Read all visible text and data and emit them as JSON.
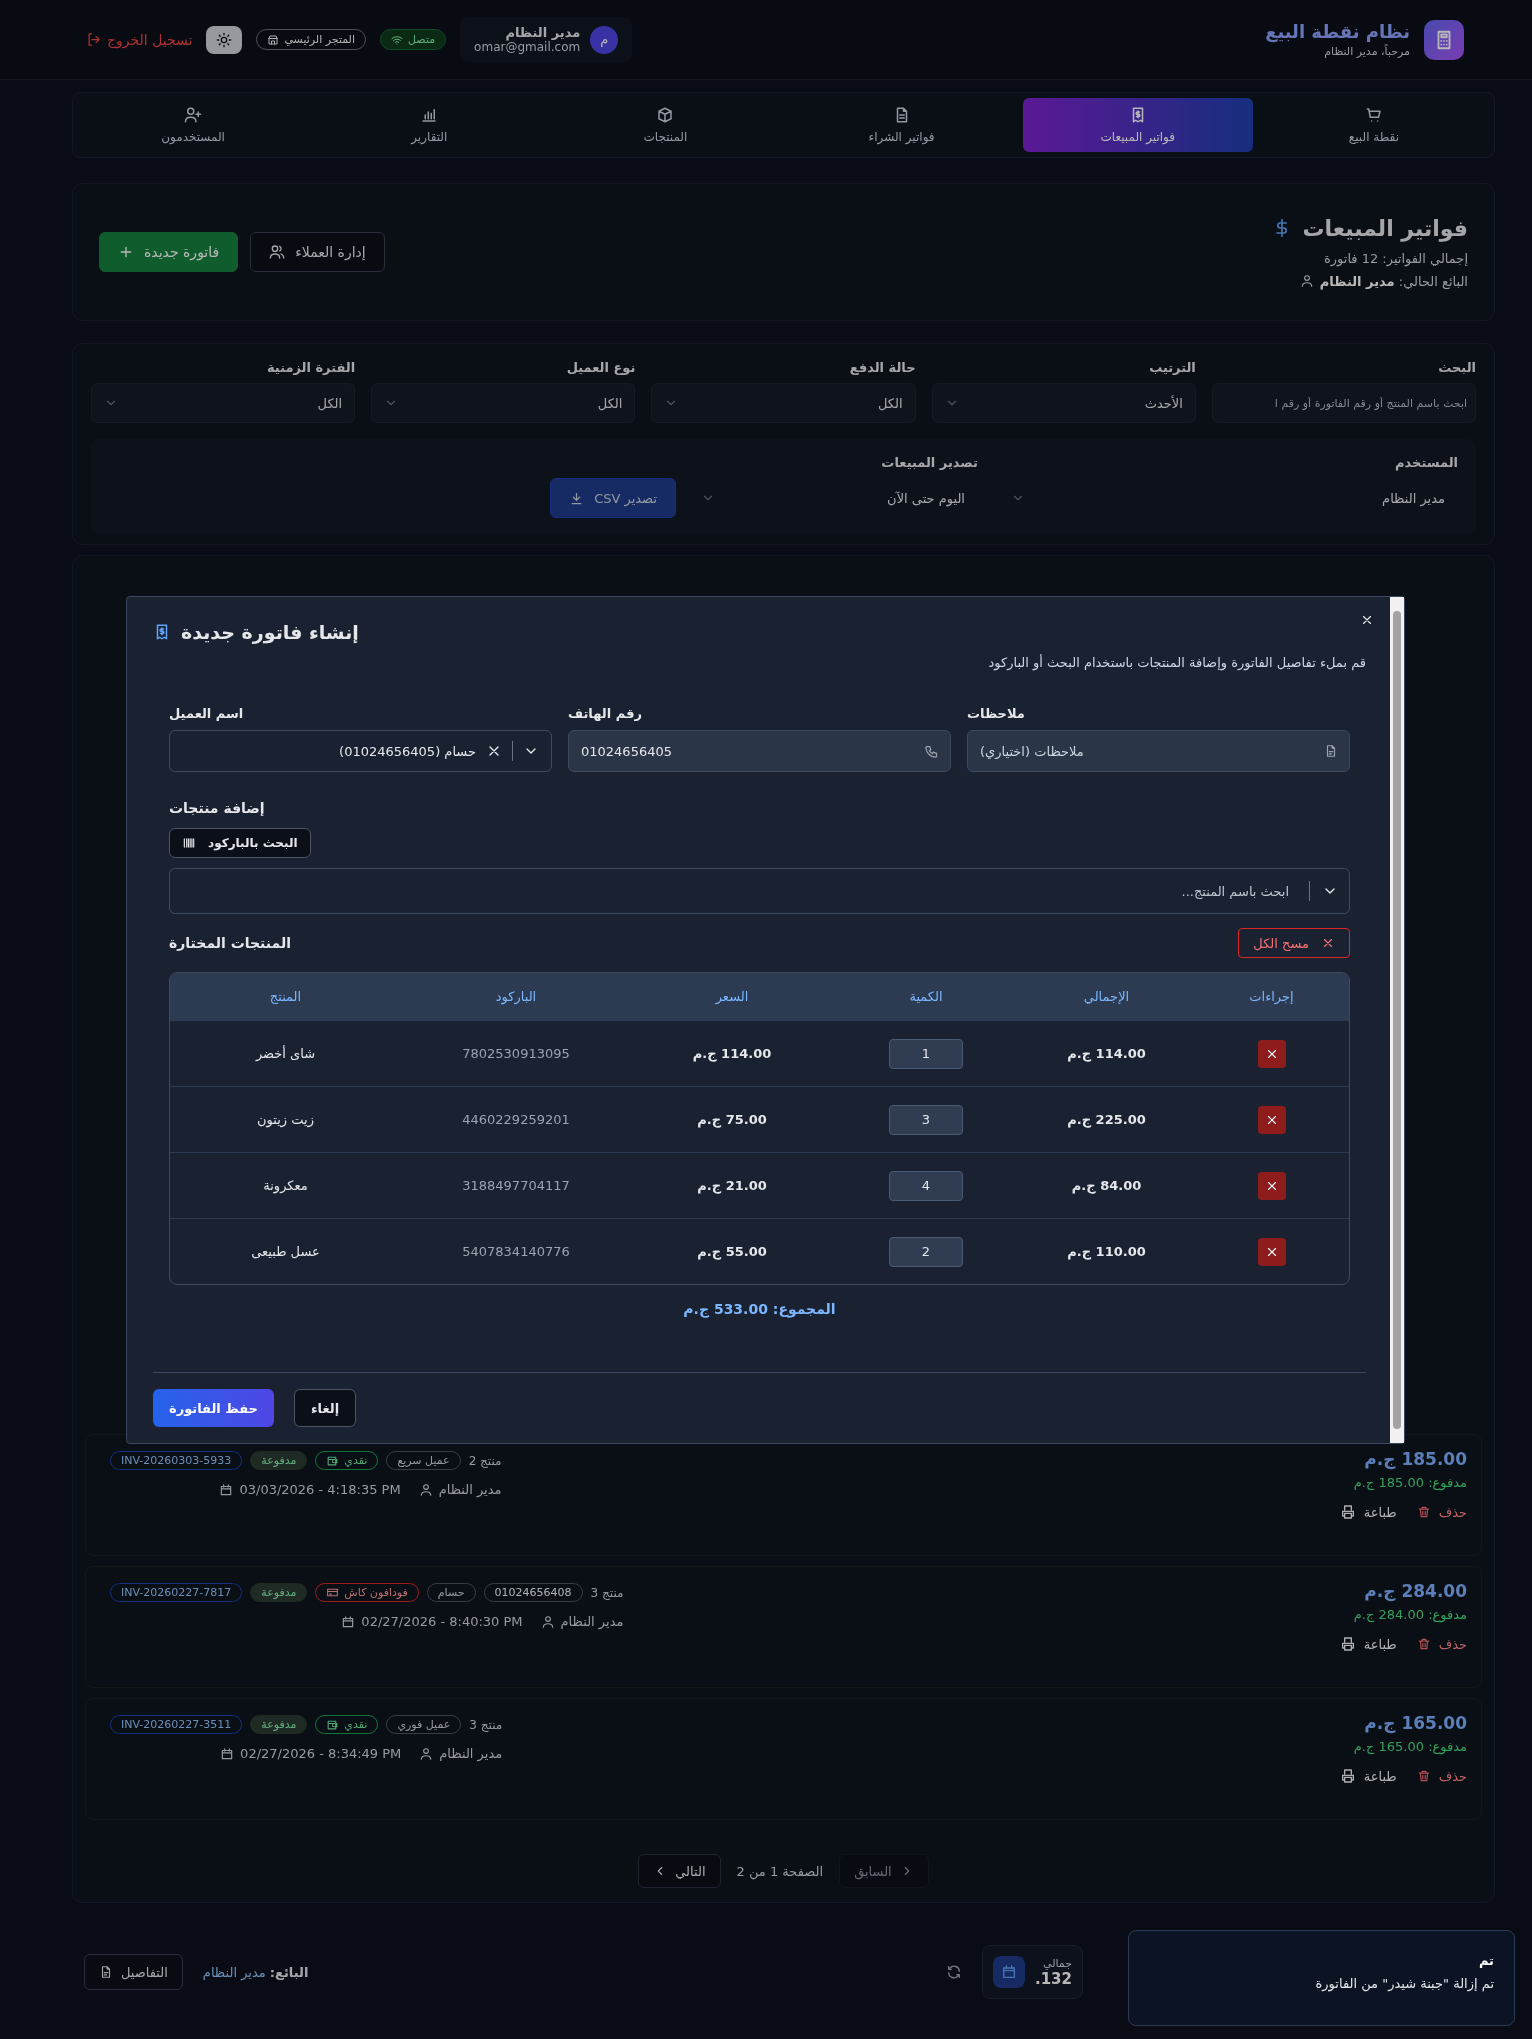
{
  "header": {
    "title": "نظام نقطة البيع",
    "subtitle": "مرحباً، مدير النظام",
    "user": {
      "avatar": "م",
      "name": "مدير النظام",
      "email": "omar@gmail.com"
    },
    "connection": {
      "label": "متصل",
      "online": true
    },
    "store": "المتجر الرئيسي",
    "logout": "تسجيل الخروج"
  },
  "nav": [
    {
      "label": "نقطة البيع",
      "kind": "cart",
      "selected": false
    },
    {
      "label": "فواتير المبيعات",
      "kind": "receipt",
      "selected": true
    },
    {
      "label": "فواتير الشراء",
      "kind": "file",
      "selected": false
    },
    {
      "label": "المنتجات",
      "kind": "box",
      "selected": false
    },
    {
      "label": "التقارير",
      "kind": "chart",
      "selected": false
    },
    {
      "label": "المستخدمون",
      "kind": "users",
      "selected": false
    }
  ],
  "page": {
    "title": "فواتير المبيعات",
    "total": "إجمالي الفواتير: 12 فاتورة",
    "seller": "البائع الحالي: **مدير النظام**",
    "buttons": [
      {
        "label": "إدارة العملاء",
        "kind": "outline"
      },
      {
        "label": "فاتورة جديدة",
        "kind": "primary"
      }
    ]
  },
  "filters": [
    {
      "label": "البحث",
      "kind": "input",
      "placeholder": "ابحث باسم المنتج أو رقم الفاتورة أو رقم ا"
    },
    {
      "label": "الترتيب",
      "kind": "select",
      "value": "الأحدث"
    },
    {
      "label": "حالة الدفع",
      "kind": "select",
      "value": "الكل"
    },
    {
      "label": "نوع العميل",
      "kind": "select",
      "value": "الكل"
    },
    {
      "label": "الفترة الزمنية",
      "kind": "select",
      "value": "الكل"
    }
  ],
  "export": {
    "user_label": "المستخدم",
    "user_value": "مدير النظام",
    "label": "تصدير المبيعات",
    "period": "اليوم حتى الآن",
    "button": "تصدير CSV"
  },
  "invoices": [
    {
      "items": "منتج 2",
      "tags": [
        {
          "text": "عميل سريع",
          "kind": "customer"
        },
        {
          "text": "نقدي",
          "kind": "cash"
        },
        {
          "text": "مدفوعة",
          "kind": "status"
        },
        {
          "text": "INV-20260303-5933",
          "kind": "id"
        }
      ],
      "user": "مدير النظام",
      "date": "03/03/2026 - 4:18:35 PM",
      "amount": "185.00 ج.م",
      "paid": "مدفوع: 185.00 ج.م",
      "actions": [
        {
          "label": "حذف",
          "kind": "delete"
        },
        {
          "label": "طباعة",
          "kind": "print"
        }
      ]
    },
    {
      "items": "منتج 3",
      "tags": [
        {
          "text": "01024656408",
          "kind": "phone"
        },
        {
          "text": "حسام",
          "kind": "customer"
        },
        {
          "text": "فودافون كاش",
          "kind": "mobile_wallet"
        },
        {
          "text": "مدفوعة",
          "kind": "status"
        },
        {
          "text": "INV-20260227-7817",
          "kind": "id"
        }
      ],
      "user": "مدير النظام",
      "date": "02/27/2026 - 8:40:30 PM",
      "amount": "284.00 ج.م",
      "paid": "مدفوع: 284.00 ج.م",
      "actions": [
        {
          "label": "حذف",
          "kind": "delete"
        },
        {
          "label": "طباعة",
          "kind": "print"
        }
      ]
    },
    {
      "items": "منتج 3",
      "tags": [
        {
          "text": "عميل فوري",
          "kind": "customer"
        },
        {
          "text": "نقدي",
          "kind": "cash"
        },
        {
          "text": "مدفوعة",
          "kind": "status"
        },
        {
          "text": "INV-20260227-3511",
          "kind": "id"
        }
      ],
      "user": "مدير النظام",
      "date": "02/27/2026 - 8:34:49 PM",
      "amount": "165.00 ج.م",
      "paid": "مدفوع: 165.00 ج.م",
      "actions": [
        {
          "label": "حذف",
          "kind": "delete"
        },
        {
          "label": "طباعة",
          "kind": "print"
        }
      ]
    }
  ],
  "pagination": {
    "prev": {
      "label": "السابق",
      "disabled": true
    },
    "page": "الصفحة 1 من 2",
    "next": {
      "label": "التالي",
      "disabled": false
    }
  },
  "bottom": {
    "summary_label": "جمالي",
    "summary_value": "132.",
    "seller": "**البائع:** مدير النظام",
    "details": "التفاصيل"
  },
  "modal": {
    "title": "إنشاء فاتورة جديدة",
    "subtitle": "قم بملء تفاصيل الفاتورة وإضافة المنتجات باستخدام البحث أو الباركود",
    "fields": [
      {
        "label": "ملاحظات",
        "kind": "notes",
        "placeholder": "ملاحظات (اختياري)"
      },
      {
        "label": "رقم الهاتف",
        "kind": "phone",
        "value": "01024656405"
      },
      {
        "label": "اسم العميل",
        "kind": "select",
        "value": "حسام (01024656405)"
      }
    ],
    "add_title": "إضافة منتجات",
    "barcode_button": "البحث بالباركود",
    "product_search": {
      "placeholder": "ابحث باسم المنتج..."
    },
    "selected_title": "المنتجات المختارة",
    "clear_button": "مسح الكل",
    "columns": [
      "إجراءات",
      "الإجمالي",
      "الكمية",
      "السعر",
      "الباركود",
      "المنتج"
    ],
    "rows": [
      {
        "product": "شاى أخضر",
        "barcode": "7802530913095",
        "price": "114.00 ج.م",
        "quantity": "1",
        "total": "114.00 ج.م"
      },
      {
        "product": "زيت زيتون",
        "barcode": "4460229259201",
        "price": "75.00 ج.م",
        "quantity": "3",
        "total": "225.00 ج.م"
      },
      {
        "product": "معكرونة",
        "barcode": "3188497704117",
        "price": "21.00 ج.م",
        "quantity": "4",
        "total": "84.00 ج.م"
      },
      {
        "product": "عسل طبيعى",
        "barcode": "5407834140776",
        "price": "55.00 ج.م",
        "quantity": "2",
        "total": "110.00 ج.م"
      }
    ],
    "total": "المجموع: 533.00 ج.م",
    "buttons": [
      {
        "label": "إلغاء",
        "kind": "secondary"
      },
      {
        "label": "حفظ الفاتورة",
        "kind": "primary"
      }
    ]
  },
  "toast": {
    "title": "تم",
    "message": "تم إزالة \"جبنة شيدر\" من الفاتورة"
  }
}
